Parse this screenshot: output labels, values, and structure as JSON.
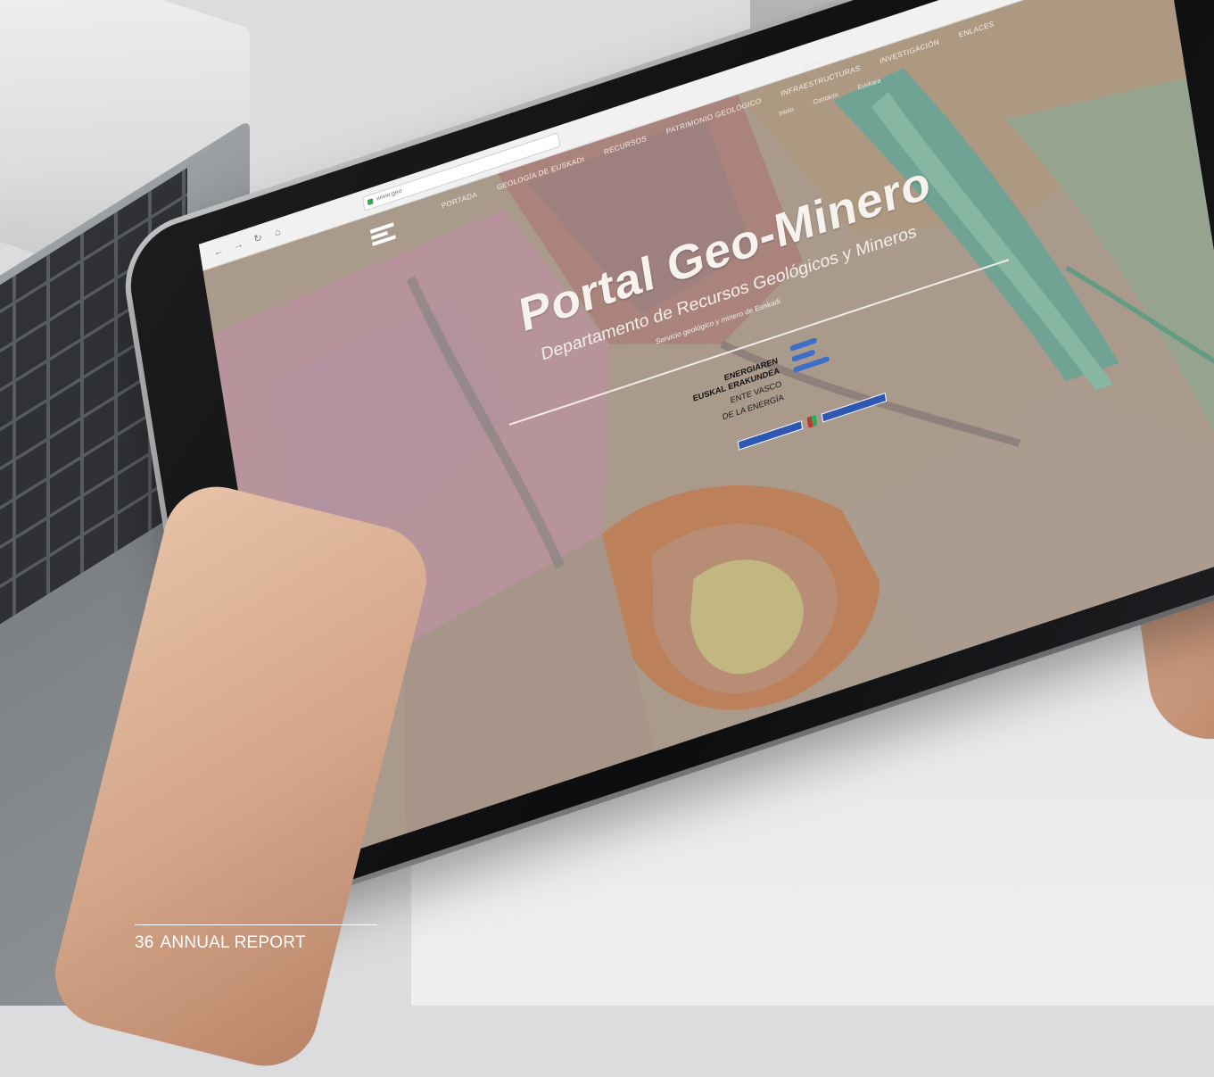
{
  "browser": {
    "url": "www.geo",
    "nav_icons": [
      "back-icon",
      "forward-icon",
      "reload-icon",
      "home-icon"
    ],
    "window_controls": "– ▢ ×"
  },
  "site": {
    "nav": [
      "PORTADA",
      "GEOLOGÍA DE EUSKADI",
      "RECURSOS",
      "PATRIMONIO GEOLÓGICO",
      "INFRAESTRUCTURAS",
      "INVESTIGACIÓN",
      "ENLACES"
    ],
    "subnav": [
      "Inicio",
      "Contacto",
      "Euskara"
    ]
  },
  "hero": {
    "title": "Portal Geo-Minero",
    "subtitle": "Departamento de Recursos Geológicos y Mineros",
    "tagline": "Servicio geológico y minero de Euskadi"
  },
  "brand": {
    "name_line1": "ENERGIAREN",
    "name_line2": "EUSKAL ERAKUNDEA",
    "tag_line1": "ENTE VASCO",
    "tag_line2": "DE LA ENERGÍA"
  },
  "footer": {
    "page_number": "36",
    "label": "ANNUAL REPORT"
  },
  "colors": {
    "map_pink": "#c9a3ad",
    "map_tan": "#bca992",
    "map_teal": "#6fb7a3",
    "map_orange": "#d08a5a",
    "brand_blue": "#3d6fc8"
  }
}
